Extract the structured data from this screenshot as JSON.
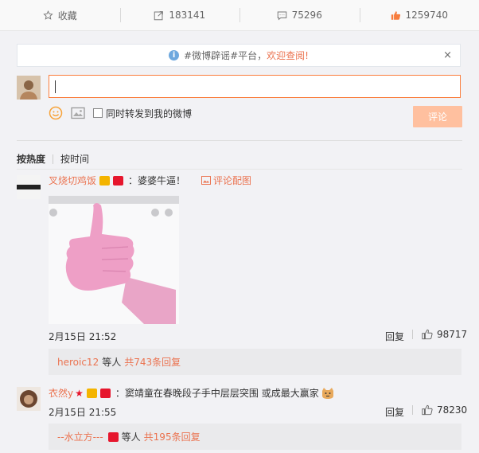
{
  "actions": {
    "favorite": {
      "label": "收藏",
      "icon": "star-icon"
    },
    "repost": {
      "count": "183141",
      "icon": "share-icon"
    },
    "comment": {
      "count": "75296",
      "icon": "comment-icon"
    },
    "like": {
      "count": "1259740",
      "icon": "thumbs-up-icon"
    }
  },
  "notice": {
    "prefix": "#微博辟谣#平台，",
    "highlight": "欢迎查阅!",
    "close": "×"
  },
  "compose": {
    "input_value": "",
    "repost_checkbox_label": "同时转发到我的微博",
    "submit_label": "评论"
  },
  "sort": {
    "by_heat": "按热度",
    "by_time": "按时间"
  },
  "comments": [
    {
      "user": "叉烧切鸡饭",
      "text": "：婆婆牛逼！",
      "pic_note": "评论配图",
      "time": "2月15日 21:52",
      "reply": "回复",
      "likes": "98717",
      "sub": {
        "user": "heroic12",
        "mid": "等人",
        "count": "共743条回复"
      }
    },
    {
      "user": "衣然y",
      "text": "：窦靖童在春晚段子手中层层突围 或成最大赢家",
      "time": "2月15日 21:55",
      "reply": "回复",
      "likes": "78230",
      "sub": {
        "user": "--水立方---",
        "mid": "等人",
        "count": "共195条回复"
      }
    }
  ],
  "colors": {
    "accent": "#eb7350",
    "input_border": "#fa7d3c",
    "submit": "#ffc09f",
    "like_orange": "#f77c3d"
  }
}
